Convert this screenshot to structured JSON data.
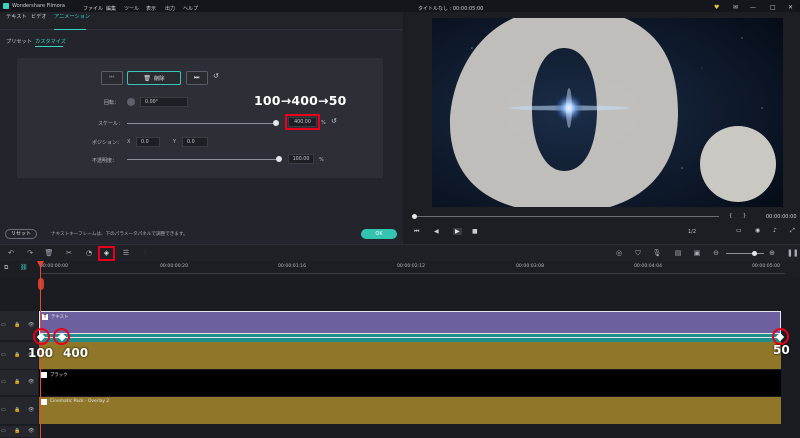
{
  "app": {
    "title": "Wondershare Filmora"
  },
  "menu": [
    "ファイル",
    "編集",
    "ツール",
    "表示",
    "出力",
    "ヘルプ"
  ],
  "top_right": {
    "project_title": "タイトルなし : 00:00:05:00"
  },
  "panel": {
    "tabs": [
      "テキスト",
      "ビデオ",
      "アニメーション"
    ],
    "active_tab": "アニメーション",
    "subtabs": [
      "プリセット",
      "カスタマイズ"
    ],
    "active_subtab": "カスタマイズ",
    "delete_label": "削除",
    "rotation": {
      "label": "回転：",
      "value": "0.00°"
    },
    "scale": {
      "label": "スケール：",
      "value": "400.00",
      "unit": "%",
      "slider_level": 0.98
    },
    "position": {
      "label": "ポジション：",
      "x_label": "X",
      "x_value": "0.0",
      "y_label": "Y",
      "y_value": "0.0"
    },
    "opacity": {
      "label": "不透明度：",
      "value": "100.00",
      "unit": "%",
      "slider_level": 1.0
    },
    "annotation": "100→400→50",
    "reset_label": "リセット",
    "hint": "ナキストキーフレームは、下のパラメータパネルで調整できます。",
    "ok_label": "OK"
  },
  "preview": {
    "time_current": "00:00:00:00",
    "ratio": "1/2",
    "bracket_left": "{",
    "bracket_right": "}"
  },
  "timeline": {
    "ruler": [
      "00:00:00:00",
      "00:00:00:20",
      "00:00:01:16",
      "00:00:02:12",
      "00:00:03:08",
      "00:00:04:04",
      "00:00:05:00"
    ],
    "tracks": [
      {
        "label": "テキスト",
        "color": "#6c609e"
      },
      {
        "label": "ブラック",
        "color": "#000000"
      },
      {
        "label": "Cinematic Pack - Overlay 2",
        "color": "#8f7628"
      }
    ],
    "keyframe_labels": [
      "100",
      "400",
      "50"
    ]
  },
  "colors": {
    "accent": "#39d2c0",
    "highlight": "#e8001c",
    "playhead": "#e8472e",
    "text_clip": "#6c609e",
    "overlay_clip": "#8f7628"
  }
}
